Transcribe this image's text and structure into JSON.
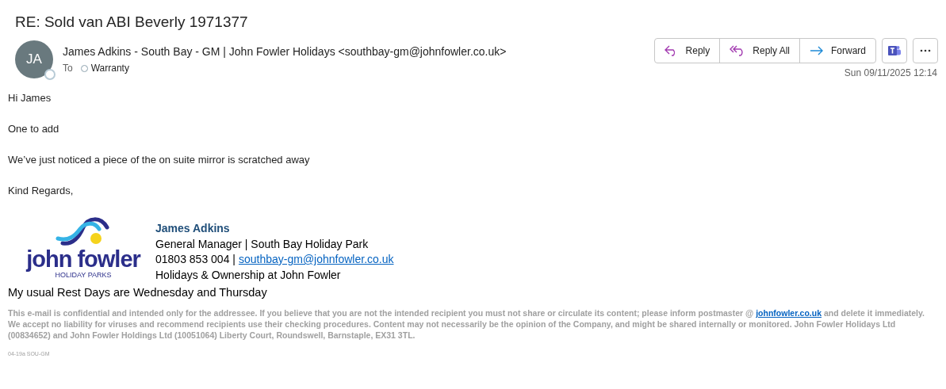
{
  "subject": "RE: Sold van ABI Beverly 1971377",
  "sender": {
    "initials": "JA",
    "name": "James Adkins - South Bay - GM | John Fowler Holidays <southbay-gm@johnfowler.co.uk>",
    "to_label": "To",
    "recipients": [
      "Warranty"
    ],
    "date": "Sun 09/11/2025 12:14"
  },
  "actions": [
    {
      "kind": "reply",
      "label": "Reply"
    },
    {
      "kind": "reply-all",
      "label": "Reply All"
    },
    {
      "kind": "forward",
      "label": "Forward"
    }
  ],
  "body": [
    "Hi James",
    "One to add",
    "We’ve just noticed a piece of the on suite mirror is scratched away",
    "Kind Regards,"
  ],
  "signature": {
    "logo_word": "john fowler",
    "logo_sub": "HOLIDAY PARKS",
    "name": "James Adkins",
    "title": "General Manager | South Bay Holiday Park",
    "phone": "01803 853 004 |",
    "email": "southbay-gm@johnfowler.co.uk",
    "tagline": "Holidays & Ownership at John Fowler"
  },
  "rest_days": "My usual Rest Days are Wednesday and Thursday",
  "disclaimer": {
    "before": "This e-mail is confidential and intended only for the addressee. If you believe that you are not the intended recipient you must not share or circulate its content; please inform postmaster @",
    "link": "johnfowler.co.uk",
    "after": "and delete it immediately. We accept no liability for viruses and recommend recipients use their checking procedures. Content may not necessarily be the opinion of the Company, and might be shared internally or monitored. John Fowler Holidays Ltd (00834652) and John Fowler Holdings Ltd (10051064) Liberty Court, Roundswell, Barnstaple, EX31 3TL."
  },
  "footer_code": "04-19a SOU-GM"
}
